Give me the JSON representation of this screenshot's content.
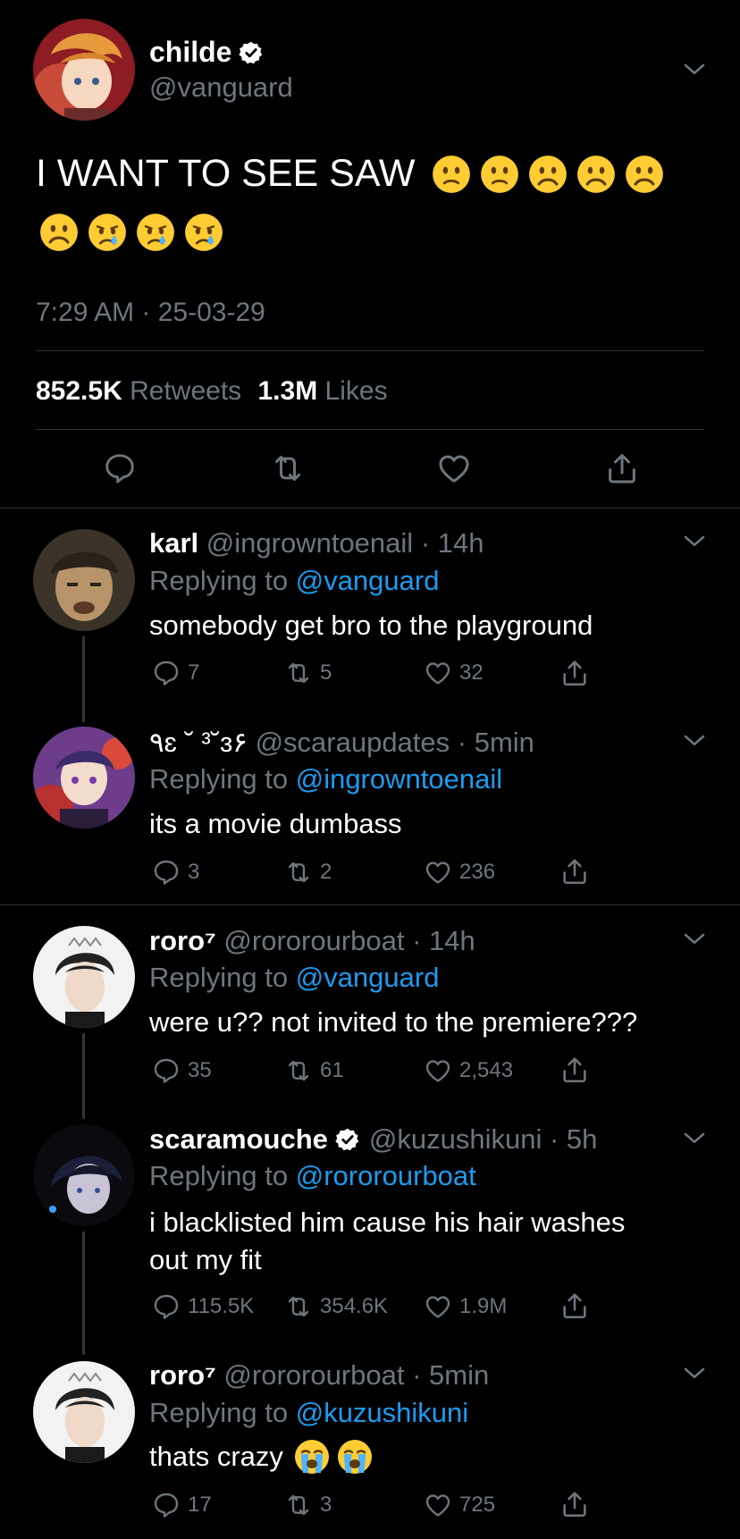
{
  "main_tweet": {
    "display_name": "childe",
    "handle": "@vanguard",
    "verified": true,
    "text": "I WANT TO SEE SAW",
    "emoji_line1": [
      "slightly-frowning-face",
      "slightly-frowning-face",
      "frowning-face",
      "frowning-face",
      "frowning-face"
    ],
    "emoji_line2": [
      "frowning-face",
      "crying-face",
      "crying-face",
      "crying-face"
    ],
    "time": "7:29 AM · 25-03-29",
    "retweets_count": "852.5K",
    "retweets_label": "Retweets",
    "likes_count": "1.3M",
    "likes_label": "Likes"
  },
  "replies": [
    {
      "display_name": "karl",
      "handle": "@ingrowntoenail",
      "time": "· 14h",
      "replying_label": "Replying to",
      "replying_to": "@vanguard",
      "text": "somebody get bro to the playground",
      "replies": "7",
      "retweets": "5",
      "likes": "32"
    },
    {
      "display_name": "٩ɛ ˘ ³˘ɜ۶",
      "handle": "@scaraupdates",
      "time": "· 5min",
      "replying_label": "Replying to",
      "replying_to": "@ingrowntoenail",
      "text": "its a movie dumbass",
      "replies": "3",
      "retweets": "2",
      "likes": "236"
    },
    {
      "display_name": "roro⁷",
      "handle": "@rororourboat",
      "time": "· 14h",
      "replying_label": "Replying to",
      "replying_to": "@vanguard",
      "text": "were u?? not invited to the premiere???",
      "replies": "35",
      "retweets": "61",
      "likes": "2,543"
    },
    {
      "display_name": "scaramouche",
      "verified": true,
      "handle": "@kuzushikuni",
      "time": "· 5h",
      "replying_label": "Replying to",
      "replying_to": "@rororourboat",
      "text_line1": "i blacklisted him cause his hair washes",
      "text_line2": "out my fit",
      "replies": "115.5K",
      "retweets": "354.6K",
      "likes": "1.9M"
    },
    {
      "display_name": "roro⁷",
      "handle": "@rororourboat",
      "time": "· 5min",
      "replying_label": "Replying to",
      "replying_to": "@kuzushikuni",
      "text": "thats crazy",
      "emoji": [
        "loudly-crying-face",
        "loudly-crying-face"
      ],
      "replies": "17",
      "retweets": "3",
      "likes": "725"
    }
  ],
  "colors": {
    "background": "#000000",
    "muted": "#6e767d",
    "link": "#1d9bf0",
    "divider": "#2f3336"
  }
}
